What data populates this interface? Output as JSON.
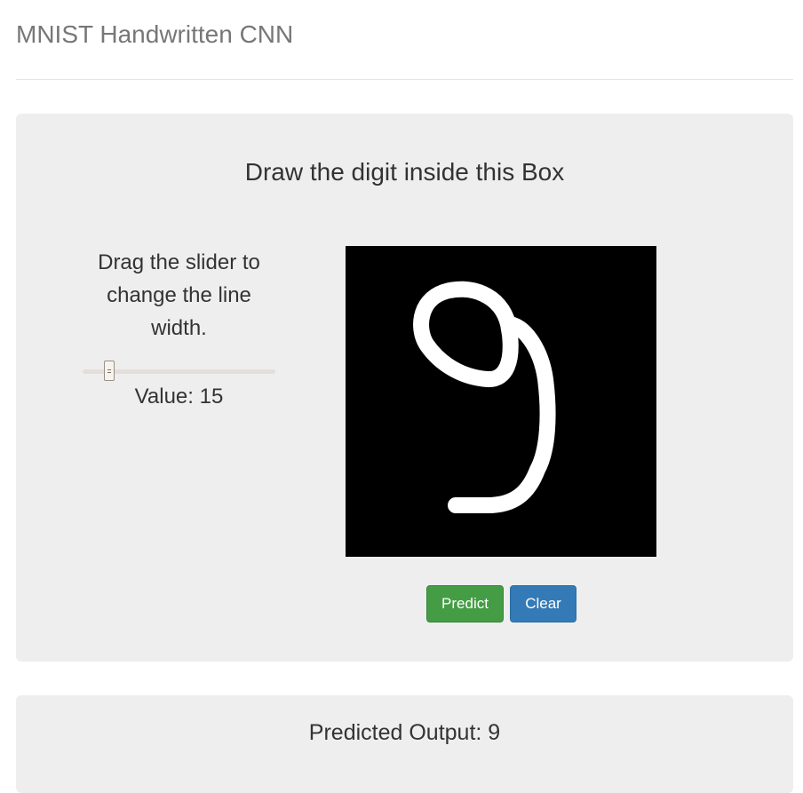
{
  "app": {
    "title": "MNIST Handwritten CNN"
  },
  "draw_panel": {
    "heading": "Draw the digit inside this Box",
    "instructions": "Drag the slider to change the line width.",
    "slider": {
      "value_label": "Value: 15",
      "value": 15,
      "min": 1,
      "max": 100,
      "track_color": "#e3ded9"
    },
    "canvas": {
      "background": "#000000",
      "stroke_color": "#ffffff",
      "digit_drawn": "9"
    },
    "buttons": {
      "predict_label": "Predict",
      "clear_label": "Clear"
    }
  },
  "output_panel": {
    "text": "Predicted Output: 9"
  },
  "colors": {
    "panel_bg": "#eeeeee",
    "predict_green": "#449d44",
    "clear_blue": "#337ab7",
    "title_gray": "#777777"
  }
}
